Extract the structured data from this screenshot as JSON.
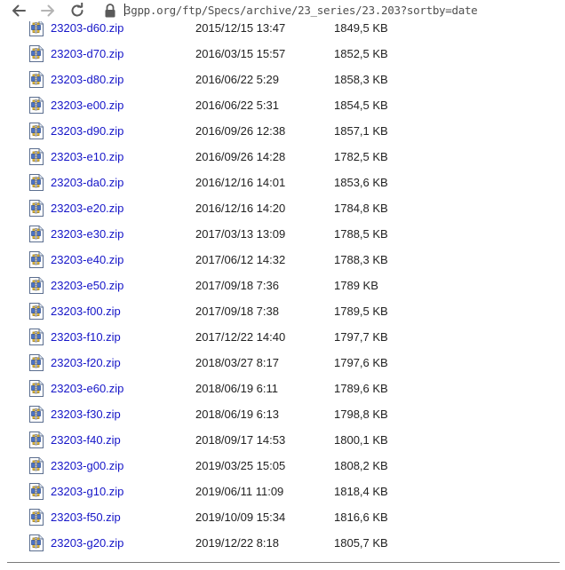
{
  "browser": {
    "url": "3gpp.org/ftp/Specs/archive/23_series/23.203?sortby=date"
  },
  "files": [
    {
      "name": "23203-d60.zip",
      "date": "2015/12/15 13:47",
      "size": "1849,5 KB"
    },
    {
      "name": "23203-d70.zip",
      "date": "2016/03/15 15:57",
      "size": "1852,5 KB"
    },
    {
      "name": "23203-d80.zip",
      "date": "2016/06/22 5:29",
      "size": "1858,3 KB"
    },
    {
      "name": "23203-e00.zip",
      "date": "2016/06/22 5:31",
      "size": "1854,5 KB"
    },
    {
      "name": "23203-d90.zip",
      "date": "2016/09/26 12:38",
      "size": "1857,1 KB"
    },
    {
      "name": "23203-e10.zip",
      "date": "2016/09/26 14:28",
      "size": "1782,5 KB"
    },
    {
      "name": "23203-da0.zip",
      "date": "2016/12/16 14:01",
      "size": "1853,6 KB"
    },
    {
      "name": "23203-e20.zip",
      "date": "2016/12/16 14:20",
      "size": "1784,8 KB"
    },
    {
      "name": "23203-e30.zip",
      "date": "2017/03/13 13:09",
      "size": "1788,5 KB"
    },
    {
      "name": "23203-e40.zip",
      "date": "2017/06/12 14:32",
      "size": "1788,3 KB"
    },
    {
      "name": "23203-e50.zip",
      "date": "2017/09/18 7:36",
      "size": "1789 KB"
    },
    {
      "name": "23203-f00.zip",
      "date": "2017/09/18 7:38",
      "size": "1789,5 KB"
    },
    {
      "name": "23203-f10.zip",
      "date": "2017/12/22 14:40",
      "size": "1797,7 KB"
    },
    {
      "name": "23203-f20.zip",
      "date": "2018/03/27 8:17",
      "size": "1797,6 KB"
    },
    {
      "name": "23203-e60.zip",
      "date": "2018/06/19 6:11",
      "size": "1789,6 KB"
    },
    {
      "name": "23203-f30.zip",
      "date": "2018/06/19 6:13",
      "size": "1798,8 KB"
    },
    {
      "name": "23203-f40.zip",
      "date": "2018/09/17 14:53",
      "size": "1800,1 KB"
    },
    {
      "name": "23203-g00.zip",
      "date": "2019/03/25 15:05",
      "size": "1808,2 KB"
    },
    {
      "name": "23203-g10.zip",
      "date": "2019/06/11 11:09",
      "size": "1818,4 KB"
    },
    {
      "name": "23203-f50.zip",
      "date": "2019/10/09 15:34",
      "size": "1816,6 KB"
    },
    {
      "name": "23203-g20.zip",
      "date": "2019/12/22 8:18",
      "size": "1805,7 KB"
    }
  ]
}
